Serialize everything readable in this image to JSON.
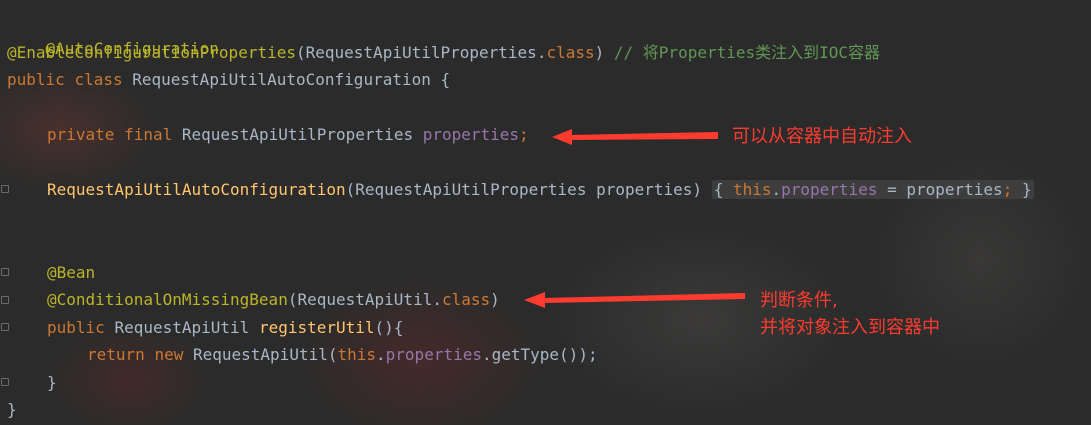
{
  "colors": {
    "background": "#2b2b2b",
    "annotation": "#bbb529",
    "keyword": "#cc7832",
    "field": "#9876aa",
    "method": "#ffc66d",
    "comment": "#629755",
    "text": "#a9b7c6",
    "note_red": "#ff3b30"
  },
  "code": {
    "l1": {
      "ann": "@AutoConfiguration"
    },
    "l2": {
      "ann": "@EnableConfigurationProperties",
      "open": "(",
      "type": "RequestApiUtilProperties",
      "dot": ".",
      "kw": "class",
      "close": ")",
      "comment": " // 将Properties类注入到IOC容器"
    },
    "l3": {
      "kw1": "public",
      "kw2": "class",
      "name": "RequestApiUtilAutoConfiguration",
      "brace": "{"
    },
    "l4": {
      "kw1": "private",
      "kw2": "final",
      "type": "RequestApiUtilProperties",
      "field": "properties",
      "semi": ";"
    },
    "l5": {
      "ctor": "RequestApiUtilAutoConfiguration",
      "params": "(RequestApiUtilProperties properties)",
      "body_open": "{ ",
      "this": "this",
      "dot": ".",
      "field": "properties",
      "assign": " = properties",
      "semi": ";",
      "body_close": " }"
    },
    "l6": {
      "ann": "@Bean"
    },
    "l7": {
      "ann": "@ConditionalOnMissingBean",
      "open": "(",
      "type": "RequestApiUtil",
      "dot": ".",
      "kw": "class",
      "close": ")"
    },
    "l8": {
      "kw1": "public",
      "type": "RequestApiUtil",
      "method": "registerUtil",
      "parens": "()",
      "brace": "{"
    },
    "l9": {
      "kw1": "return",
      "kw2": "new",
      "type": "RequestApiUtil",
      "open": "(",
      "this": "this",
      "dot": ".",
      "field": "properties",
      "call": ".getType()",
      "close": ");"
    },
    "l10": {
      "brace": "}"
    },
    "l11": {
      "brace": "}"
    }
  },
  "notes": {
    "n1": "可以从容器中自动注入",
    "n2a": "判断条件,",
    "n2b": "并将对象注入到容器中"
  }
}
